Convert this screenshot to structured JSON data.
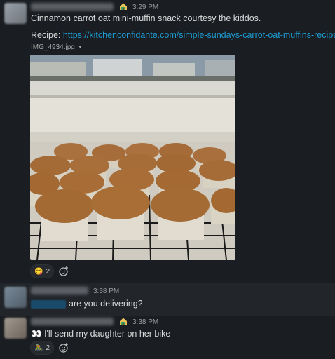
{
  "messages": [
    {
      "time": "3:29 PM",
      "text": "Cinnamon carrot oat mini-muffin snack courtesy the kiddos.",
      "recipe_prefix": "Recipe: ",
      "recipe_link": "https://kitchenconfidante.com/simple-sundays-carrot-oat-muffins-recipe",
      "file_name": "IMG_4934.jpg",
      "reaction": {
        "emoji": "😋",
        "count": "2"
      }
    },
    {
      "time": "3:38 PM",
      "text": "are you delivering?"
    },
    {
      "time": "3:38 PM",
      "emoji": "👀",
      "text": "I'll send my daughter on her bike",
      "reaction": {
        "emoji": "🚴",
        "count": "2"
      }
    }
  ],
  "icons": {
    "status": "house-icon",
    "add_reaction": "add-reaction-icon",
    "file_menu": "chevron-down-icon"
  },
  "colors": {
    "background": "#1a1d21",
    "link": "#1d9bd1",
    "text": "#d8d9da",
    "timestamp": "#9a9b9d"
  }
}
